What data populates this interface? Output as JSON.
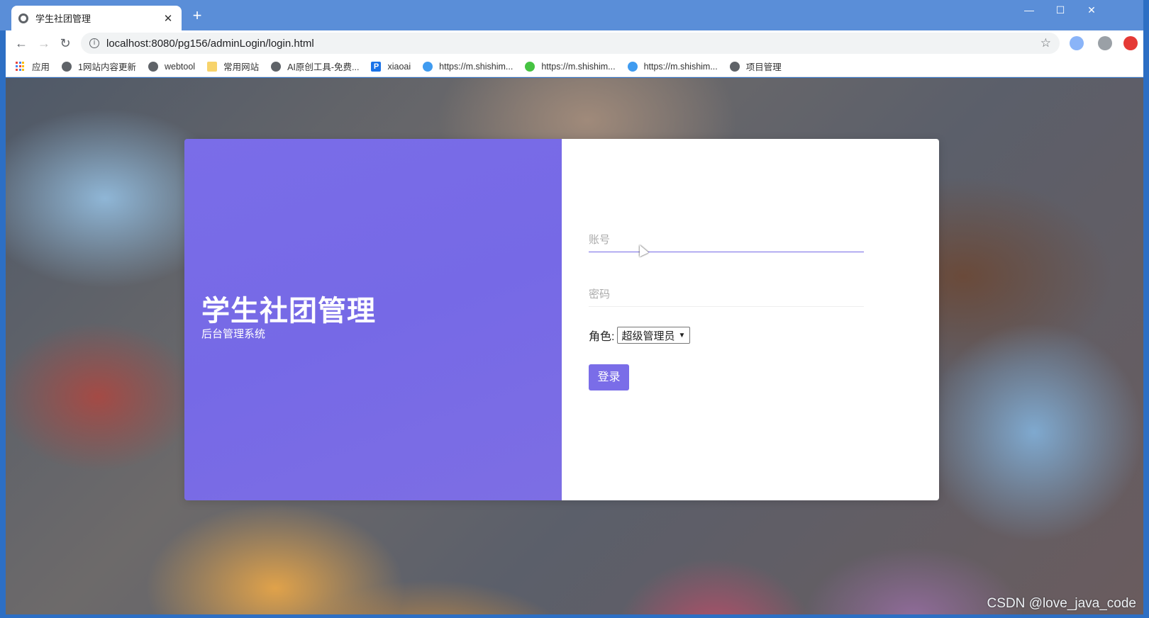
{
  "browser": {
    "tab_title": "学生社团管理",
    "tab_close": "✕",
    "new_tab": "+",
    "window_controls": {
      "minimize": "—",
      "maximize": "☐",
      "close": "✕"
    },
    "url": "localhost:8080/pg156/adminLogin/login.html",
    "nav": {
      "back": "←",
      "forward": "→",
      "reload": "↻"
    },
    "info_icon": "i",
    "star": "☆",
    "bookmarks": [
      {
        "label": "应用",
        "icon": "apps-grid-icon"
      },
      {
        "label": "1网站内容更新",
        "icon": "globe-icon"
      },
      {
        "label": "webtool",
        "icon": "globe-icon"
      },
      {
        "label": "常用网站",
        "icon": "folder-icon"
      },
      {
        "label": "AI原创工具-免费...",
        "icon": "globe-icon"
      },
      {
        "label": "xiaoai",
        "icon": "p-logo-icon"
      },
      {
        "label": "https://m.shishim...",
        "icon": "c-logo-icon"
      },
      {
        "label": "https://m.shishim...",
        "icon": "wechat-icon"
      },
      {
        "label": "https://m.shishim...",
        "icon": "c-logo-icon"
      },
      {
        "label": "项目管理",
        "icon": "globe-icon"
      }
    ],
    "p_letter": "P"
  },
  "login": {
    "brand_title": "学生社团管理",
    "brand_subtitle": "后台管理系统",
    "account_placeholder": "账号",
    "password_placeholder": "密码",
    "role_label": "角色:",
    "role_selected": "超级管理员",
    "login_button": "登录"
  },
  "watermark": "CSDN @love_java_code",
  "colors": {
    "accent": "#7a6de8",
    "titlebar": "#5a8ed8"
  }
}
